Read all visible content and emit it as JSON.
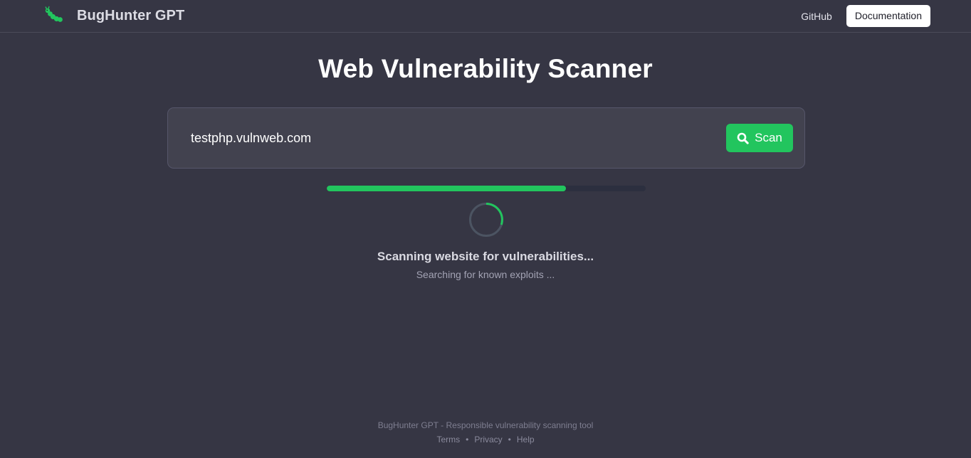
{
  "app": {
    "name": "BugHunter GPT",
    "logo_icon": "caterpillar-icon",
    "accent_color": "#22c55e"
  },
  "nav": {
    "github_label": "GitHub",
    "docs_label": "Documentation"
  },
  "main": {
    "title": "Web Vulnerability Scanner",
    "url_input_value": "testphp.vulnweb.com",
    "scan_button_label": "Scan",
    "scan_button_icon": "search-icon",
    "progress_fraction": 0.75,
    "spinner_icon": "loading-spinner-icon",
    "status_title": "Scanning website for vulnerabilities...",
    "status_detail": "Searching for known exploits ..."
  },
  "footer": {
    "tagline": "BugHunter GPT - Responsible vulnerability scanning tool",
    "links": [
      "Terms",
      "Privacy",
      "Help"
    ],
    "separator": "•"
  }
}
